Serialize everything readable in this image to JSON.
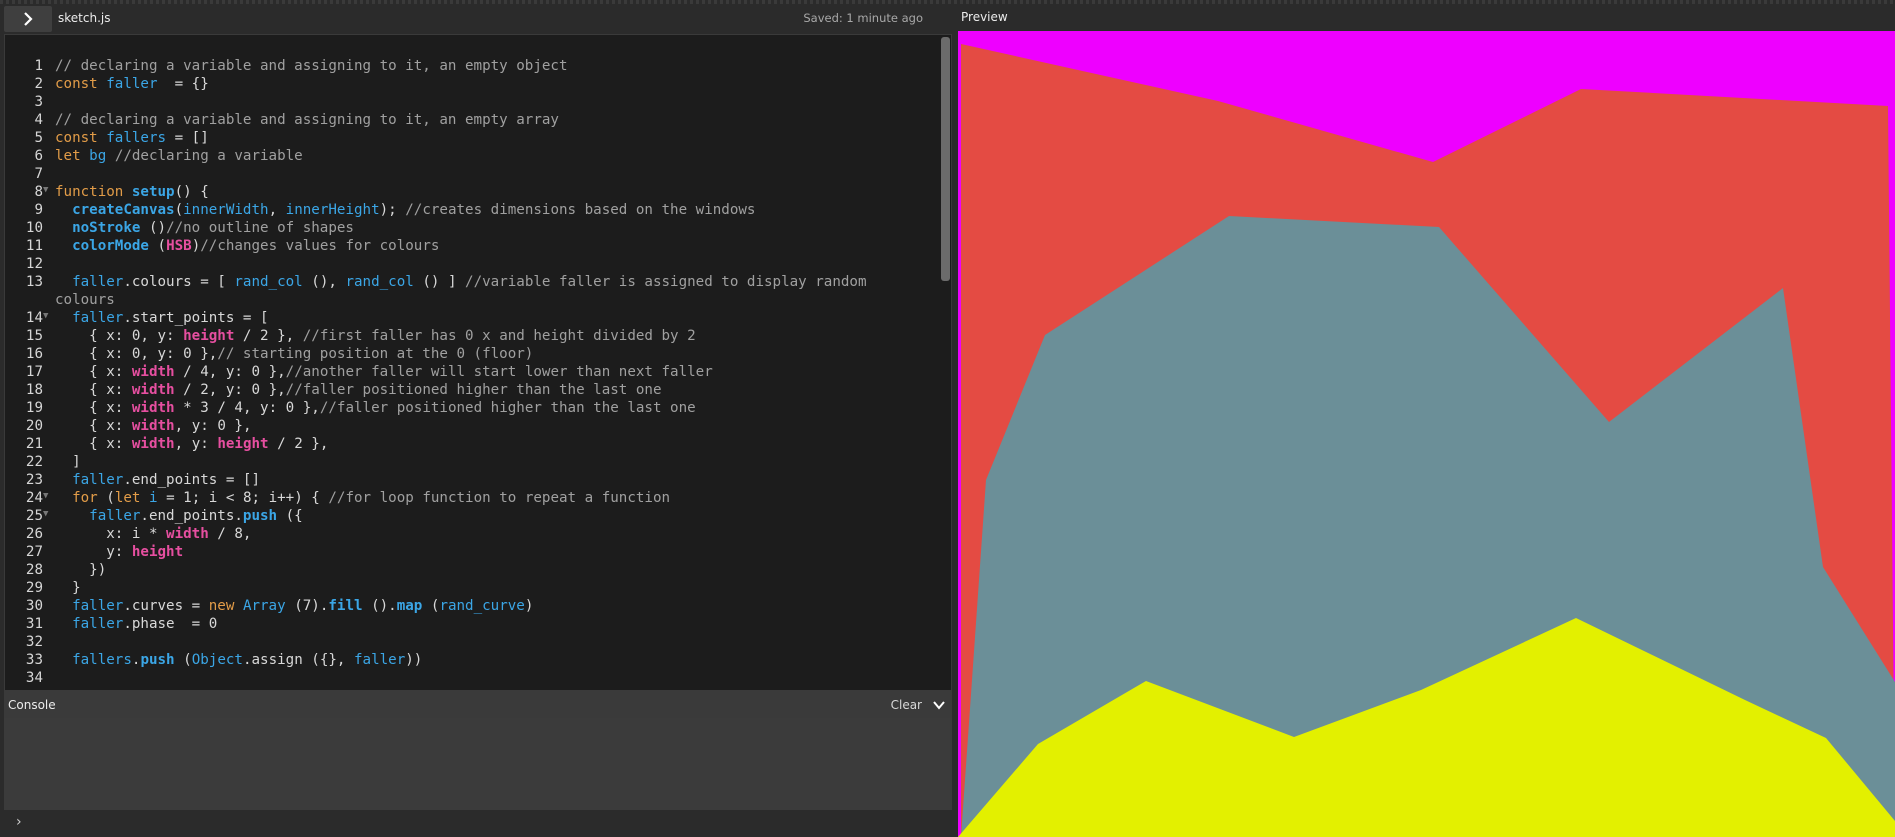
{
  "editor": {
    "filename": "sketch.js",
    "saved_status": "Saved: 1 minute ago"
  },
  "console": {
    "title": "Console",
    "clear_label": "Clear",
    "prompt": "›"
  },
  "preview": {
    "title": "Preview"
  },
  "colors": {
    "background_magenta": "#ee00ff",
    "band_red": "#e44b43",
    "band_teal": "#6b8f98",
    "band_yellow": "#e3f000"
  },
  "code_lines": [
    {
      "n": "1",
      "text": "// declaring a variable and assigning to it, an empty object"
    },
    {
      "n": "2",
      "text": "const faller  = {}"
    },
    {
      "n": "3",
      "text": ""
    },
    {
      "n": "4",
      "text": "// declaring a variable and assigning to it, an empty array"
    },
    {
      "n": "5",
      "text": "const fallers = []"
    },
    {
      "n": "6",
      "text": "let bg //declaring a variable"
    },
    {
      "n": "7",
      "text": ""
    },
    {
      "n": "8",
      "text": "function setup() {"
    },
    {
      "n": "9",
      "text": "  createCanvas(innerWidth, innerHeight); //creates dimensions based on the windows"
    },
    {
      "n": "10",
      "text": "  noStroke ()//no outline of shapes"
    },
    {
      "n": "11",
      "text": "  colorMode (HSB)//changes values for colours"
    },
    {
      "n": "12",
      "text": ""
    },
    {
      "n": "13",
      "text": "  faller.colours = [ rand_col (), rand_col () ] //variable faller is assigned to display random colours"
    },
    {
      "n": "14",
      "text": "  faller.start_points = ["
    },
    {
      "n": "15",
      "text": "    { x: 0, y: height / 2 }, //first faller has 0 x and height divided by 2"
    },
    {
      "n": "16",
      "text": "    { x: 0, y: 0 },// starting position at the 0 (floor)"
    },
    {
      "n": "17",
      "text": "    { x: width / 4, y: 0 },//another faller will start lower than next faller"
    },
    {
      "n": "18",
      "text": "    { x: width / 2, y: 0 },//faller positioned higher than the last one"
    },
    {
      "n": "19",
      "text": "    { x: width * 3 / 4, y: 0 },//faller positioned higher than the last one"
    },
    {
      "n": "20",
      "text": "    { x: width, y: 0 },"
    },
    {
      "n": "21",
      "text": "    { x: width, y: height / 2 },"
    },
    {
      "n": "22",
      "text": "  ]"
    },
    {
      "n": "23",
      "text": "  faller.end_points = []"
    },
    {
      "n": "24",
      "text": "  for (let i = 1; i < 8; i++) { //for loop function to repeat a function"
    },
    {
      "n": "25",
      "text": "    faller.end_points.push ({"
    },
    {
      "n": "26",
      "text": "      x: i * width / 8,"
    },
    {
      "n": "27",
      "text": "      y: height"
    },
    {
      "n": "28",
      "text": "    })"
    },
    {
      "n": "29",
      "text": "  }"
    },
    {
      "n": "30",
      "text": "  faller.curves = new Array (7).fill ().map (rand_curve)"
    },
    {
      "n": "31",
      "text": "  faller.phase  = 0"
    },
    {
      "n": "32",
      "text": ""
    },
    {
      "n": "33",
      "text": "  fallers.push (Object.assign ({}, faller))"
    },
    {
      "n": "34",
      "text": ""
    }
  ]
}
